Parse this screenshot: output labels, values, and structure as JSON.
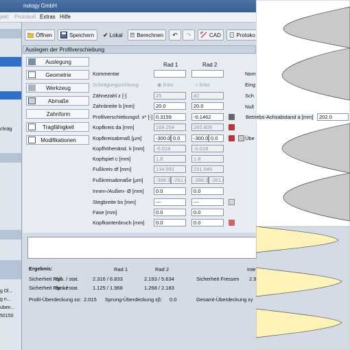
{
  "window": {
    "title": "nology GmbH"
  },
  "menu": {
    "items": [
      "jekt",
      "Protokoll",
      "Extras",
      "Hilfe"
    ]
  },
  "left_panel": {
    "items": [
      "chräg",
      "g Dl...",
      "g n...",
      "uben...",
      "50150"
    ]
  },
  "toolbar": {
    "open_label": "Öffnen",
    "save_label": "Speichern",
    "local_label": "Lokal",
    "local_checked": true,
    "calc_label": "Berechnen",
    "cad_label": "CAD",
    "protocol_label": "Protoko"
  },
  "panel": {
    "header": "Auslegen der Profilverschiebung"
  },
  "nav": {
    "items": [
      "Auslegung",
      "Geometrie",
      "Werkzeug",
      "Abmaße",
      "Zahnform",
      "Tragfähigkeit",
      "Modifikationen"
    ],
    "selected": "Auslegung"
  },
  "columns": {
    "rad1": "Rad 1",
    "rad2": "Rad 2"
  },
  "form": {
    "kommentar": {
      "label": "Kommentar",
      "r1": "",
      "r2": ""
    },
    "schraeg": {
      "label": "Schrägungsrichtung",
      "r1": "links",
      "r2": "links"
    },
    "zaehnezahl": {
      "label": "Zähnezahl z [-]",
      "r1": "25",
      "r2": "42"
    },
    "zahnbreite": {
      "label": "Zahnbreite b [mm]",
      "r1": "20.0",
      "r2": "20.0"
    },
    "profilver": {
      "label": "Profilverschiebungsf. x* [-]",
      "r1": "0.3159",
      "r2": "-0.1462"
    },
    "kopfkreis": {
      "label": "Kopfkreis da [mm]",
      "r1": "169.254",
      "r2": "265.809"
    },
    "kopfkreisabmass": {
      "label": "Kopfkreisabmaß [µm]",
      "r1a": "-300.0",
      "r1b": "0.0",
      "r2a": "-300.0",
      "r2b": "0.0"
    },
    "kopfhoehen": {
      "label": "Kopfhöhenänd. k [mm]",
      "r1": "-0.018",
      "r2": "-0.018"
    },
    "kopfspiel": {
      "label": "Kopfspiel c [mm]",
      "r1": "1.8",
      "r2": "1.8"
    },
    "fusskreis": {
      "label": "Fußkreis df [mm]",
      "r1": "134.591",
      "r2": "231.046"
    },
    "fusskreisabmasse": {
      "label": "Fußkreisabmaße [µm]",
      "r1a": "-398.3",
      "r1b": "-261.0",
      "r2a": "-398.3",
      "r2b": "-261.0"
    },
    "innen": {
      "label": "Innen-/Außen- Ø [mm]",
      "r1": "0.0",
      "r2": "0.0"
    },
    "stegbreite": {
      "label": "Stegbreite bs [mm]",
      "r1": "---",
      "r2": "---"
    },
    "fase": {
      "label": "Fase [mm]",
      "r1": "0.0",
      "r2": "0.0"
    },
    "kopfkanten": {
      "label": "Kopfkantenbruch [mm]",
      "r1": "0.0",
      "r2": "0.0"
    }
  },
  "right_labels": [
    "Nom",
    "Eing",
    "Sch",
    "Null"
  ],
  "center_distance": {
    "label": "Betriebs-Achsabstand a [mm]",
    "value": "202.0"
  },
  "ueber_label": "Übe",
  "results": {
    "title": "Ergebnis:",
    "rad1": "Rad 1",
    "rad2": "Rad 2",
    "inte": "Inte",
    "sf_label": "Sicherheit Fuß",
    "sf_kind": "dyn. / stat.",
    "sf_r1": "2.316 / 6.833",
    "sf_r2": "2.193 / 5.634",
    "sfr_label": "Sicherheit Fressen",
    "sfr_val": "2.9",
    "sh_label": "Sicherheit Flanke",
    "sh_kind": "dyn. / stat.",
    "sh_r1": "1.125 / 1.968",
    "sh_r2": "1.268 / 2.183",
    "profil_label": "Profil-Überdeckung εα:",
    "profil_val": "2.015",
    "sprung_label": "Sprung-Überdeckung εβ:",
    "sprung_val": "0.0",
    "gesamt_label": "Gesamt-Überdeckung εγ"
  },
  "colors": {
    "accent": "#2f6fcc",
    "tooth_fill": "#c9c9c9",
    "panel_bg": "#e8edf3"
  }
}
